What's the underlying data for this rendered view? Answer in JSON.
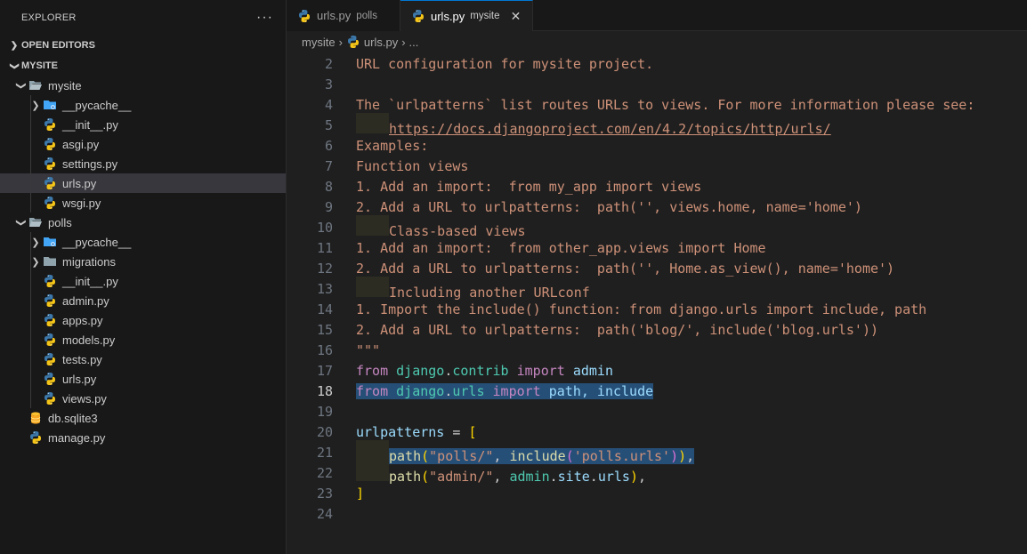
{
  "sidebar": {
    "title": "EXPLORER",
    "more": "···",
    "open_editors": "OPEN EDITORS",
    "root": "MYSITE",
    "items": [
      {
        "label": "mysite",
        "level": 1,
        "type": "folder-open"
      },
      {
        "label": "__pycache__",
        "level": 2,
        "type": "folder-closed-special"
      },
      {
        "label": "__init__.py",
        "level": 2,
        "type": "py"
      },
      {
        "label": "asgi.py",
        "level": 2,
        "type": "py"
      },
      {
        "label": "settings.py",
        "level": 2,
        "type": "py"
      },
      {
        "label": "urls.py",
        "level": 2,
        "type": "py",
        "selected": true
      },
      {
        "label": "wsgi.py",
        "level": 2,
        "type": "py"
      },
      {
        "label": "polls",
        "level": 1,
        "type": "folder-open"
      },
      {
        "label": "__pycache__",
        "level": 2,
        "type": "folder-closed-special"
      },
      {
        "label": "migrations",
        "level": 2,
        "type": "folder-closed"
      },
      {
        "label": "__init__.py",
        "level": 2,
        "type": "py"
      },
      {
        "label": "admin.py",
        "level": 2,
        "type": "py"
      },
      {
        "label": "apps.py",
        "level": 2,
        "type": "py"
      },
      {
        "label": "models.py",
        "level": 2,
        "type": "py"
      },
      {
        "label": "tests.py",
        "level": 2,
        "type": "py"
      },
      {
        "label": "urls.py",
        "level": 2,
        "type": "py"
      },
      {
        "label": "views.py",
        "level": 2,
        "type": "py"
      },
      {
        "label": "db.sqlite3",
        "level": 1,
        "type": "db"
      },
      {
        "label": "manage.py",
        "level": 1,
        "type": "py"
      }
    ]
  },
  "tabs": [
    {
      "label": "urls.py",
      "desc": "polls",
      "active": false
    },
    {
      "label": "urls.py",
      "desc": "mysite",
      "active": true,
      "close": "✕"
    }
  ],
  "breadcrumb": {
    "folder": "mysite",
    "file": "urls.py",
    "more": "..."
  },
  "code": {
    "current_line": 18,
    "lines": [
      {
        "n": "2",
        "text": "URL configuration for mysite project."
      },
      {
        "n": "3",
        "text": ""
      },
      {
        "n": "4",
        "text": "The `urlpatterns` list routes URLs to views. For more information please see:"
      },
      {
        "n": "5",
        "text": "https://docs.djangoproject.com/en/4.2/topics/http/urls/"
      },
      {
        "n": "6",
        "text": "Examples:"
      },
      {
        "n": "7",
        "text": "Function views"
      },
      {
        "n": "8",
        "text": "1. Add an import:  from my_app import views"
      },
      {
        "n": "9",
        "text": "2. Add a URL to urlpatterns:  path('', views.home, name='home')"
      },
      {
        "n": "10",
        "text": "Class-based views"
      },
      {
        "n": "11",
        "text": "1. Add an import:  from other_app.views import Home"
      },
      {
        "n": "12",
        "text": "2. Add a URL to urlpatterns:  path('', Home.as_view(), name='home')"
      },
      {
        "n": "13",
        "text": "Including another URLconf"
      },
      {
        "n": "14",
        "text": "1. Import the include() function: from django.urls import include, path"
      },
      {
        "n": "15",
        "text": "2. Add a URL to urlpatterns:  path('blog/', include('blog.urls'))"
      },
      {
        "n": "16",
        "text": "\"\"\""
      },
      {
        "n": "17",
        "text": "from django.contrib import admin"
      },
      {
        "n": "18",
        "text": "from django.urls import path, include"
      },
      {
        "n": "19",
        "text": ""
      },
      {
        "n": "20",
        "text": "urlpatterns = ["
      },
      {
        "n": "21",
        "text": "path(\"polls/\", include('polls.urls')),"
      },
      {
        "n": "22",
        "text": "path(\"admin/\", admin.site.urls),"
      },
      {
        "n": "23",
        "text": "]"
      },
      {
        "n": "24",
        "text": ""
      }
    ]
  }
}
